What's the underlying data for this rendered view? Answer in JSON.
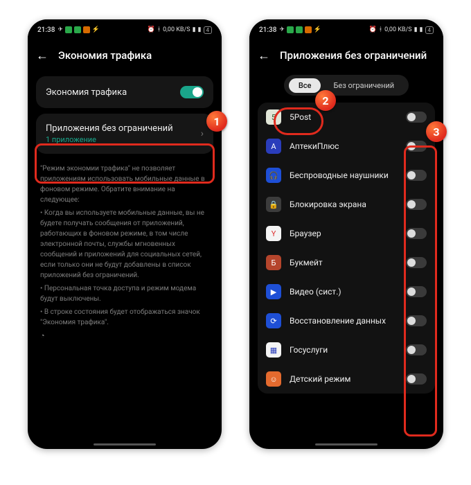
{
  "status": {
    "time": "21:38",
    "net_rate": "0,00 KB/S",
    "battery_text": "4"
  },
  "left": {
    "title": "Экономия трафика",
    "saver_label": "Экономия трафика",
    "unrestricted_label": "Приложения без ограничений",
    "unrestricted_sub": "1 приложение",
    "desc_intro": "\"Режим экономии трафика\" не позволяет приложениям использовать мобильные данные в фоновом режиме. Обратите внимание на следующее:",
    "desc_b1": "• Когда вы используете мобильные данные, вы не будете получать сообщения от приложений, работающих в фоновом режиме, в том числе электронной почты, службы мгновенных сообщений и приложений для социальных сетей, если только они не будут добавлены в список приложений без ограничений.",
    "desc_b2": "• Персональная точка доступа и режим модема будут выключены.",
    "desc_b3": "• В строке состояния будет отображаться значок \"Экономия трафика\"."
  },
  "right": {
    "title": "Приложения без ограничений",
    "tab_all": "Все",
    "tab_unrestricted": "Без ограничений",
    "apps": [
      {
        "name": "5Post",
        "icon_bg": "#e1e6d8",
        "glyph": "5",
        "glyph_color": "#2d5a2d"
      },
      {
        "name": "АптекиПлюс",
        "icon_bg": "#2a3dbb",
        "glyph": "А"
      },
      {
        "name": "Беспроводные наушники",
        "icon_bg": "#1e4fd6",
        "glyph": "🎧"
      },
      {
        "name": "Блокировка экрана",
        "icon_bg": "#3c3c3c",
        "glyph": "🔒"
      },
      {
        "name": "Браузер",
        "icon_bg": "#f4f4f4",
        "glyph": "Y",
        "glyph_color": "#d33"
      },
      {
        "name": "Букмейт",
        "icon_bg": "#b5452c",
        "glyph": "Б"
      },
      {
        "name": "Видео (сист.)",
        "icon_bg": "#1e4fd6",
        "glyph": "▶"
      },
      {
        "name": "Восстановление данных",
        "icon_bg": "#1e4fd6",
        "glyph": "⟳"
      },
      {
        "name": "Госуслуги",
        "icon_bg": "#f4f4f4",
        "glyph": "▦",
        "glyph_color": "#2a3dbb"
      },
      {
        "name": "Детский режим",
        "icon_bg": "#e46a2e",
        "glyph": "☺"
      }
    ]
  },
  "annotations": {
    "b1": "1",
    "b2": "2",
    "b3": "3"
  }
}
